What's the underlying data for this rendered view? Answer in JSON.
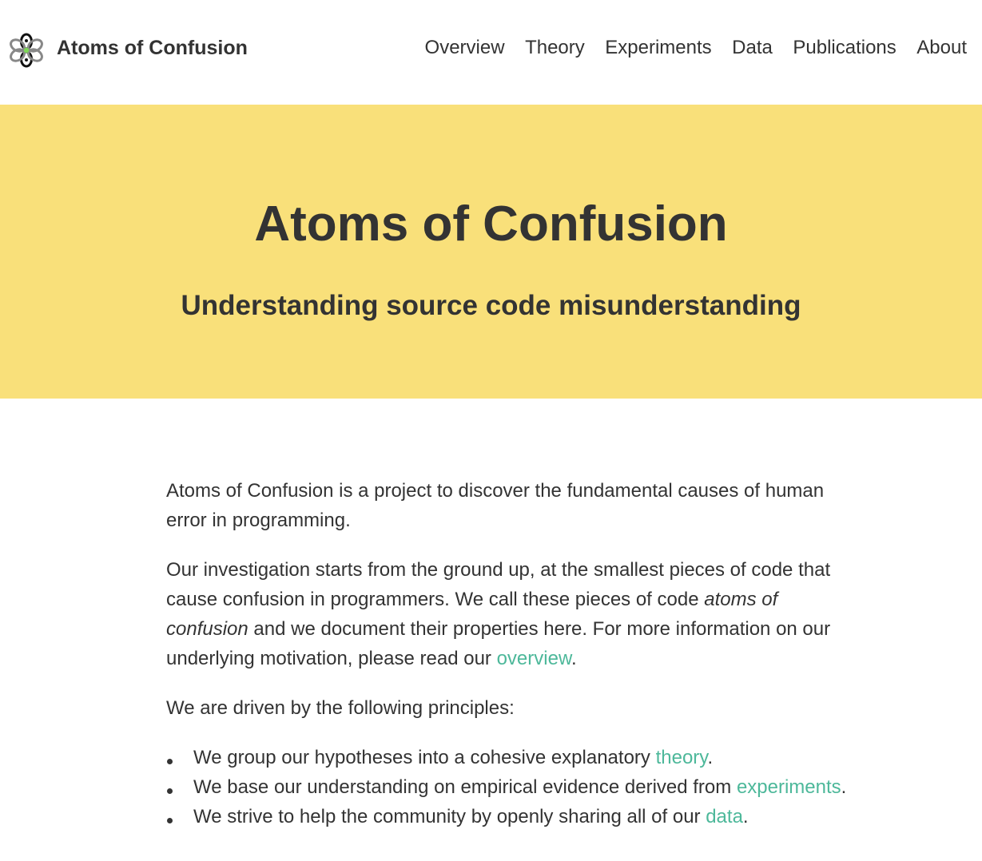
{
  "header": {
    "site_title": "Atoms of Confusion",
    "logo_icon": "atom-flower-logo-icon",
    "nav": [
      {
        "label": "Overview"
      },
      {
        "label": "Theory"
      },
      {
        "label": "Experiments"
      },
      {
        "label": "Data"
      },
      {
        "label": "Publications"
      },
      {
        "label": "About"
      }
    ]
  },
  "hero": {
    "title": "Atoms of Confusion",
    "subtitle": "Understanding source code misunderstanding",
    "background_color": "#f9e07a"
  },
  "content": {
    "p1": "Atoms of Confusion is a project to discover the fundamental causes of human error in programming.",
    "p2": {
      "before_em": "Our investigation starts from the ground up, at the smallest pieces of code that cause confusion in programmers. We call these pieces of code ",
      "em": "atoms of confusion",
      "after_em": " and we document their properties here. For more information on our underlying motivation, please read our ",
      "link": "overview",
      "end": "."
    },
    "p3": "We are driven by the following principles:",
    "principles": [
      {
        "text": "We group our hypotheses into a cohesive explanatory ",
        "link": "theory",
        "end": "."
      },
      {
        "text": "We base our understanding on empirical evidence derived from ",
        "link": "experiments",
        "end": "."
      },
      {
        "text": "We strive to help the community by openly sharing all of our ",
        "link": "data",
        "end": "."
      }
    ],
    "link_color": "#4db89a"
  }
}
